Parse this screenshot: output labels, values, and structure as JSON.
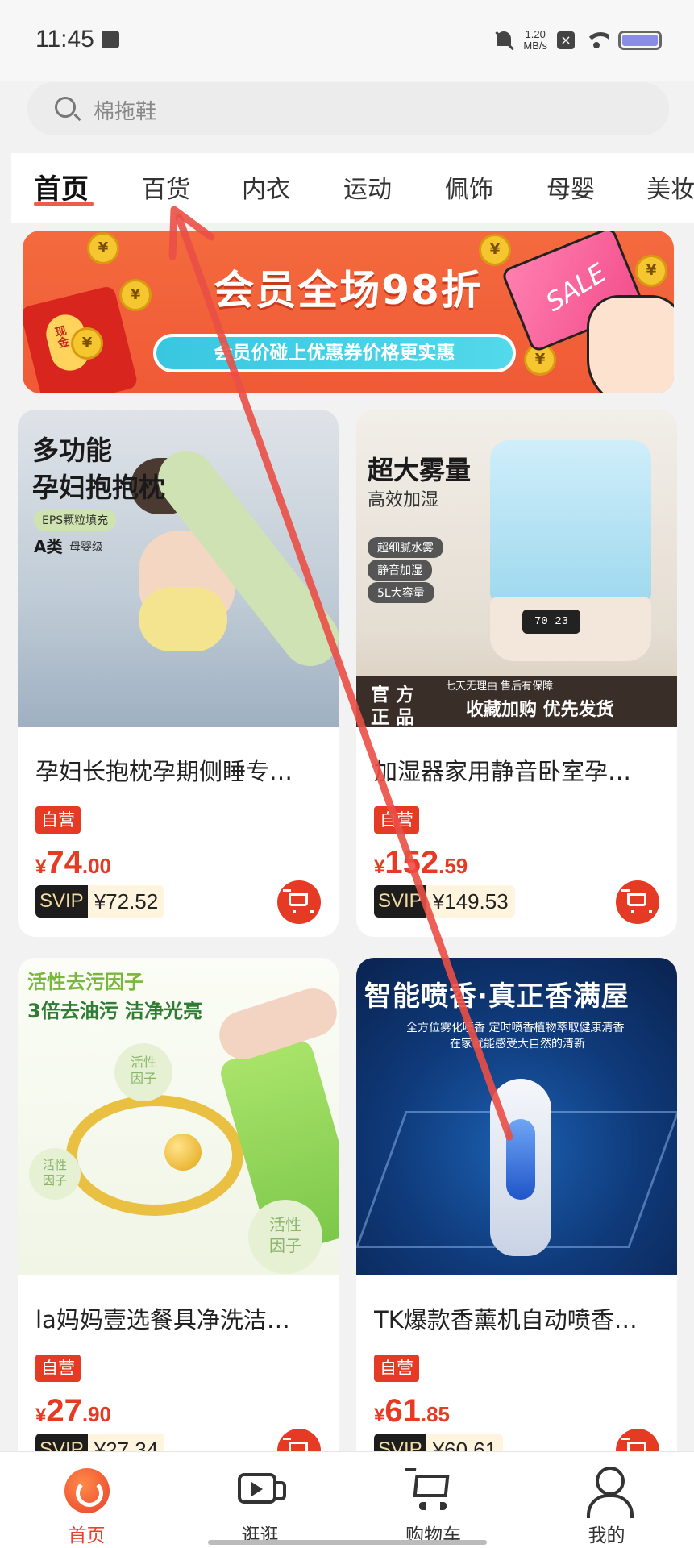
{
  "status_bar": {
    "time": "11:45",
    "net_speed_value": "1.20",
    "net_speed_unit": "MB/s"
  },
  "search": {
    "placeholder": "棉拖鞋"
  },
  "tabs": [
    {
      "label": "首页",
      "active": true
    },
    {
      "label": "百货"
    },
    {
      "label": "内衣"
    },
    {
      "label": "运动"
    },
    {
      "label": "佩饰"
    },
    {
      "label": "母婴"
    },
    {
      "label": "美妆"
    }
  ],
  "banner": {
    "title": "会员全场98折",
    "subtitle": "会员价碰上优惠券价格更实惠",
    "card_text": "SALE",
    "coin_symbol": "¥",
    "envelope_text": "现金"
  },
  "products": [
    {
      "title": "孕妇长抱枕孕期侧睡专…",
      "badge": "自营",
      "price_symbol": "¥",
      "price_int": "74",
      "price_dec": ".00",
      "svip_label": "SVIP",
      "svip_price": "¥72.52",
      "image_text": {
        "line1": "多功能",
        "line2": "孕妇抱抱枕",
        "chip": "EPS颗粒填充",
        "grade_a": "A类",
        "grade_b": "母婴级"
      }
    },
    {
      "title": "加湿器家用静音卧室孕…",
      "badge": "自营",
      "price_symbol": "¥",
      "price_int": "152",
      "price_dec": ".59",
      "svip_label": "SVIP",
      "svip_price": "¥149.53",
      "image_text": {
        "line1": "超大雾量",
        "line2": "高效加湿",
        "chip1": "超细腻水雾",
        "chip2": "静音加湿",
        "chip3": "5L大容量",
        "official_1": "官 方",
        "official_2": "正 品",
        "guarantee": "七天无理由 售后有保障",
        "slogan": "收藏加购 优先发货",
        "display": "70 23"
      }
    },
    {
      "title": "la妈妈壹选餐具净洗洁…",
      "badge": "自营",
      "price_symbol": "¥",
      "price_int": "27",
      "price_dec": ".90",
      "svip_label": "SVIP",
      "svip_price": "¥27.34",
      "image_text": {
        "line1": "活性去污因子",
        "line2": "3倍去油污 洁净光亮",
        "bubble1": "活性因子",
        "bubble2": "活性因子",
        "bubble3_a": "活性",
        "bubble3_b": "因子"
      }
    },
    {
      "title": "TK爆款香薰机自动喷香…",
      "badge": "自营",
      "price_symbol": "¥",
      "price_int": "61",
      "price_dec": ".85",
      "svip_label": "SVIP",
      "svip_price": "¥60.61",
      "image_text": {
        "line1": "智能喷香·真正香满屋",
        "line2": "全方位雾化喷香 定时喷香植物萃取健康清香",
        "line3": "在家就能感受大自然的清新"
      }
    }
  ],
  "bottom_nav": [
    {
      "label": "首页",
      "icon": "home-icon",
      "active": true
    },
    {
      "label": "逛逛",
      "icon": "video-icon"
    },
    {
      "label": "购物车",
      "icon": "cart-icon"
    },
    {
      "label": "我的",
      "icon": "user-icon"
    }
  ],
  "colors": {
    "accent": "#e8402a",
    "price_red": "#e53b24",
    "banner_orange": "#f46a3e",
    "gesture_arrow": "#ea4f46"
  }
}
